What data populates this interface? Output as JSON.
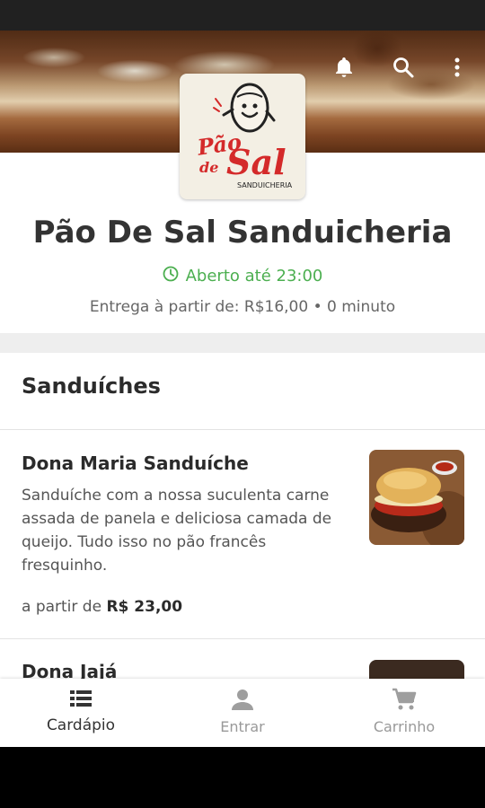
{
  "restaurant": {
    "name": "Pão De Sal Sanduicheria",
    "status": "Aberto até 23:00",
    "delivery": "Entrega à partir de: R$16,00 • 0 minuto"
  },
  "logo": {
    "line1": "Pão",
    "line2": "de",
    "line3": "Sal",
    "line4": "SANDUICHERIA"
  },
  "icons": {
    "notification": "bell-icon",
    "search": "search-icon",
    "menu": "more-vert-icon"
  },
  "section": {
    "title": "Sanduíches"
  },
  "items": [
    {
      "name": "Dona Maria Sanduíche",
      "description": "Sanduíche com a nossa suculenta carne assada de panela e deliciosa camada de queijo. Tudo isso no pão francês fresquinho.",
      "price_prefix": "a partir de",
      "price": "R$ 23,00"
    },
    {
      "name": "Dona Jajá"
    }
  ],
  "nav": [
    {
      "label": "Cardápio",
      "icon": "list-icon",
      "active": true
    },
    {
      "label": "Entrar",
      "icon": "person-icon",
      "active": false
    },
    {
      "label": "Carrinho",
      "icon": "cart-icon",
      "active": false
    }
  ],
  "colors": {
    "open_status": "#4caf50",
    "text_dark": "#333333",
    "logo_red": "#d42a2a"
  }
}
